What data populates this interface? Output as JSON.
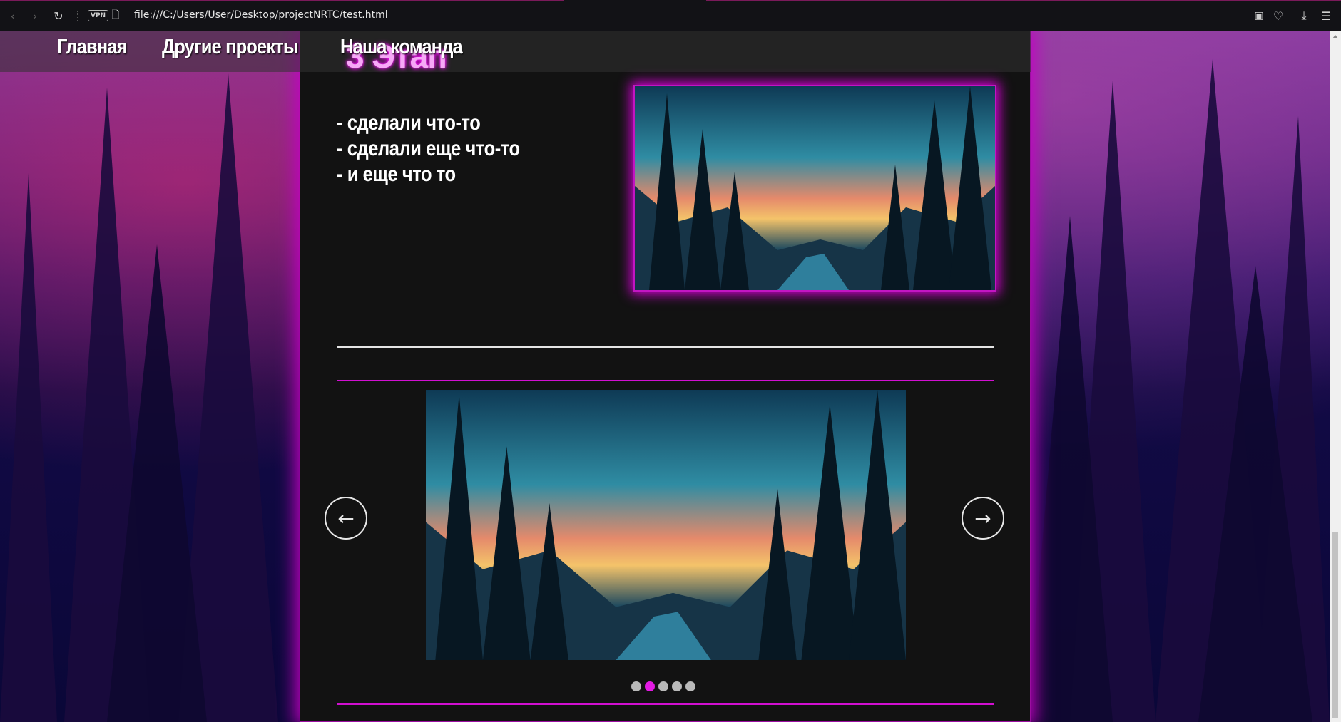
{
  "browser": {
    "url": "file:///C:/Users/User/Desktop/projectNRTC/test.html",
    "vpn_label": "VPN",
    "icons": [
      "back-icon",
      "forward-icon",
      "reload-icon",
      "vpn-badge",
      "page-icon",
      "camera-icon",
      "heart-icon",
      "download-icon",
      "menu-icon"
    ]
  },
  "nav": {
    "items": [
      "Главная",
      "Другие проекты",
      "Наша команда"
    ]
  },
  "section": {
    "title": "3 Этап",
    "bullets": [
      "- сделали что-то",
      "- сделали еще что-то",
      "- и еще что то"
    ]
  },
  "slider": {
    "prev_icon": "arrow-left-icon",
    "next_icon": "arrow-right-icon",
    "dot_count": 5,
    "active_dot": 2
  },
  "colors": {
    "accent": "#e31ae3",
    "panel": "#121212",
    "text": "#ffffff"
  }
}
